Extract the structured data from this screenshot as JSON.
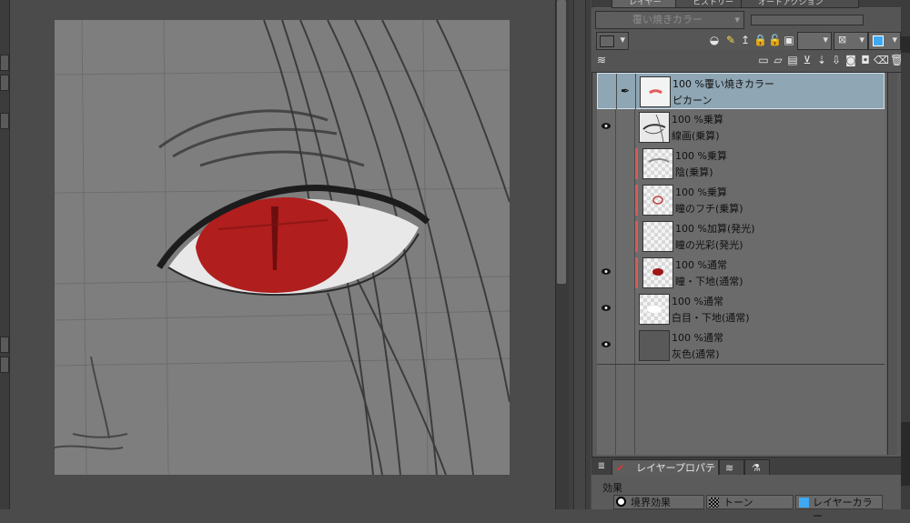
{
  "panel": {
    "tabs": [
      {
        "label": "レイヤー",
        "active": true
      },
      {
        "label": "ヒストリー",
        "active": false
      },
      {
        "label": "オートアクション",
        "active": false
      }
    ],
    "blend_mode_select": "覆い焼きカラー",
    "opacity_field": ""
  },
  "layers": [
    {
      "opacity_mode": "100 %覆い焼きカラー",
      "name": "ピカーン",
      "visible": false,
      "selected": true,
      "has_edit_icon": true,
      "clipped": false,
      "thumb": "red-mark"
    },
    {
      "opacity_mode": "100 %乗算",
      "name": "線画(乗算)",
      "visible": true,
      "selected": false,
      "clipped": false,
      "thumb": "sketch"
    },
    {
      "opacity_mode": "100 %乗算",
      "name": "陰(乗算)",
      "visible": false,
      "selected": false,
      "clipped": true,
      "thumb": "shadow"
    },
    {
      "opacity_mode": "100 %乗算",
      "name": "瞳のフチ(乗算)",
      "visible": false,
      "selected": false,
      "clipped": true,
      "thumb": "rim"
    },
    {
      "opacity_mode": "100 %加算(発光)",
      "name": "瞳の光彩(発光)",
      "visible": false,
      "selected": false,
      "clipped": true,
      "thumb": "empty"
    },
    {
      "opacity_mode": "100 %通常",
      "name": "瞳・下地(通常)",
      "visible": true,
      "selected": false,
      "clipped": true,
      "thumb": "red-iris"
    },
    {
      "opacity_mode": "100 %通常",
      "name": "白目・下地(通常)",
      "visible": true,
      "selected": false,
      "clipped": false,
      "thumb": "white"
    },
    {
      "opacity_mode": "100 %通常",
      "name": "灰色(通常)",
      "visible": true,
      "selected": false,
      "clipped": false,
      "thumb": "gray"
    }
  ],
  "properties": {
    "tabs": [
      "レイヤープロパティ",
      "",
      ""
    ],
    "section_label": "効果",
    "effects": [
      "境界効果",
      "トーン",
      "レイヤーカラー"
    ]
  },
  "colors": {
    "iris": "#b01e1e",
    "selected_layer": "#8fa6b4",
    "clip_bar": "#d55b5b",
    "layer_color_swatch": "#3fa9f5"
  }
}
